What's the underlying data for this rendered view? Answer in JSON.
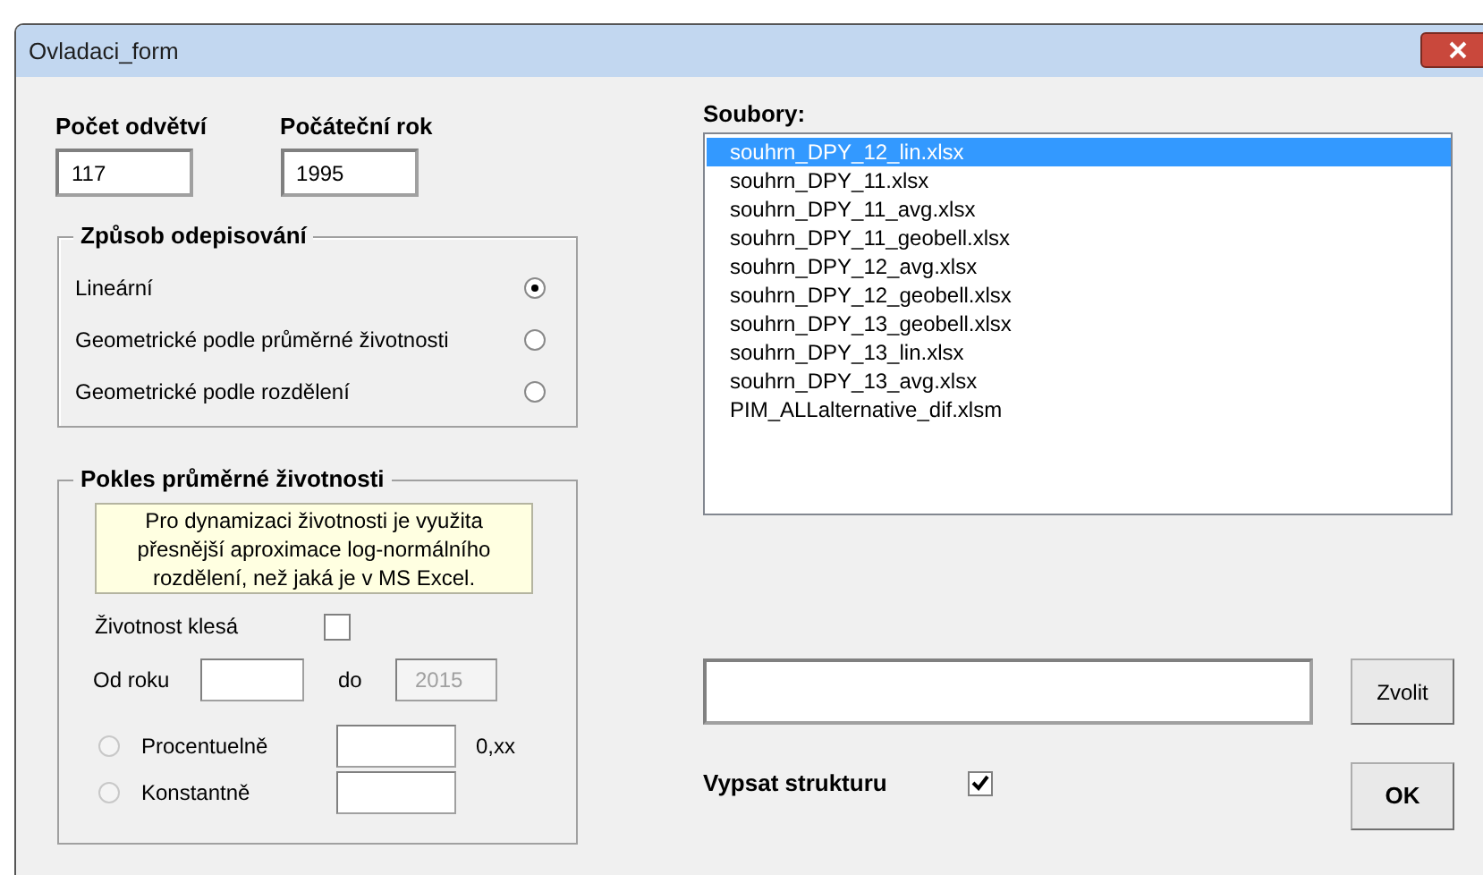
{
  "window": {
    "title": "Ovladaci_form"
  },
  "fields": [
    {
      "label": "Počet odvětví",
      "value": "117"
    },
    {
      "label": "Počáteční rok",
      "value": "1995"
    }
  ],
  "depreciation": {
    "title": "Způsob odepisování",
    "options": [
      {
        "label": "Lineární",
        "selected": true
      },
      {
        "label": "Geometrické podle průměrné životnosti",
        "selected": false
      },
      {
        "label": "Geometrické podle rozdělení",
        "selected": false
      }
    ]
  },
  "decline": {
    "title": "Pokles průměrné životnosti",
    "note": "Pro dynamizaci životnosti je využita\npřesnější aproximace log-normálního\nrozdělení, než jaká je v MS Excel.",
    "checkbox": {
      "label": "Životnost klesá",
      "checked": false
    },
    "from_label": "Od roku",
    "to_label": "do",
    "to_value": "2015",
    "to_disabled": true,
    "modes": [
      {
        "label": "Procentuelně",
        "selected": false,
        "disabled": true,
        "suffix": "0,xx"
      },
      {
        "label": "Konstantně",
        "selected": false,
        "disabled": true
      }
    ]
  },
  "files": {
    "label": "Soubory:",
    "items": [
      {
        "name": "souhrn_DPY_12_lin.xlsx",
        "selected": true
      },
      {
        "name": "souhrn_DPY_11.xlsx",
        "selected": false
      },
      {
        "name": "souhrn_DPY_11_avg.xlsx",
        "selected": false
      },
      {
        "name": "souhrn_DPY_11_geobell.xlsx",
        "selected": false
      },
      {
        "name": "souhrn_DPY_12_avg.xlsx",
        "selected": false
      },
      {
        "name": "souhrn_DPY_12_geobell.xlsx",
        "selected": false
      },
      {
        "name": "souhrn_DPY_13_geobell.xlsx",
        "selected": false
      },
      {
        "name": "souhrn_DPY_13_lin.xlsx",
        "selected": false
      },
      {
        "name": "souhrn_DPY_13_avg.xlsx",
        "selected": false
      },
      {
        "name": "PIM_ALLalternative_dif.xlsm",
        "selected": false
      }
    ]
  },
  "choose_button": "Zvolit",
  "structure": {
    "label": "Vypsat strukturu",
    "checked": true
  },
  "ok_button": "OK"
}
